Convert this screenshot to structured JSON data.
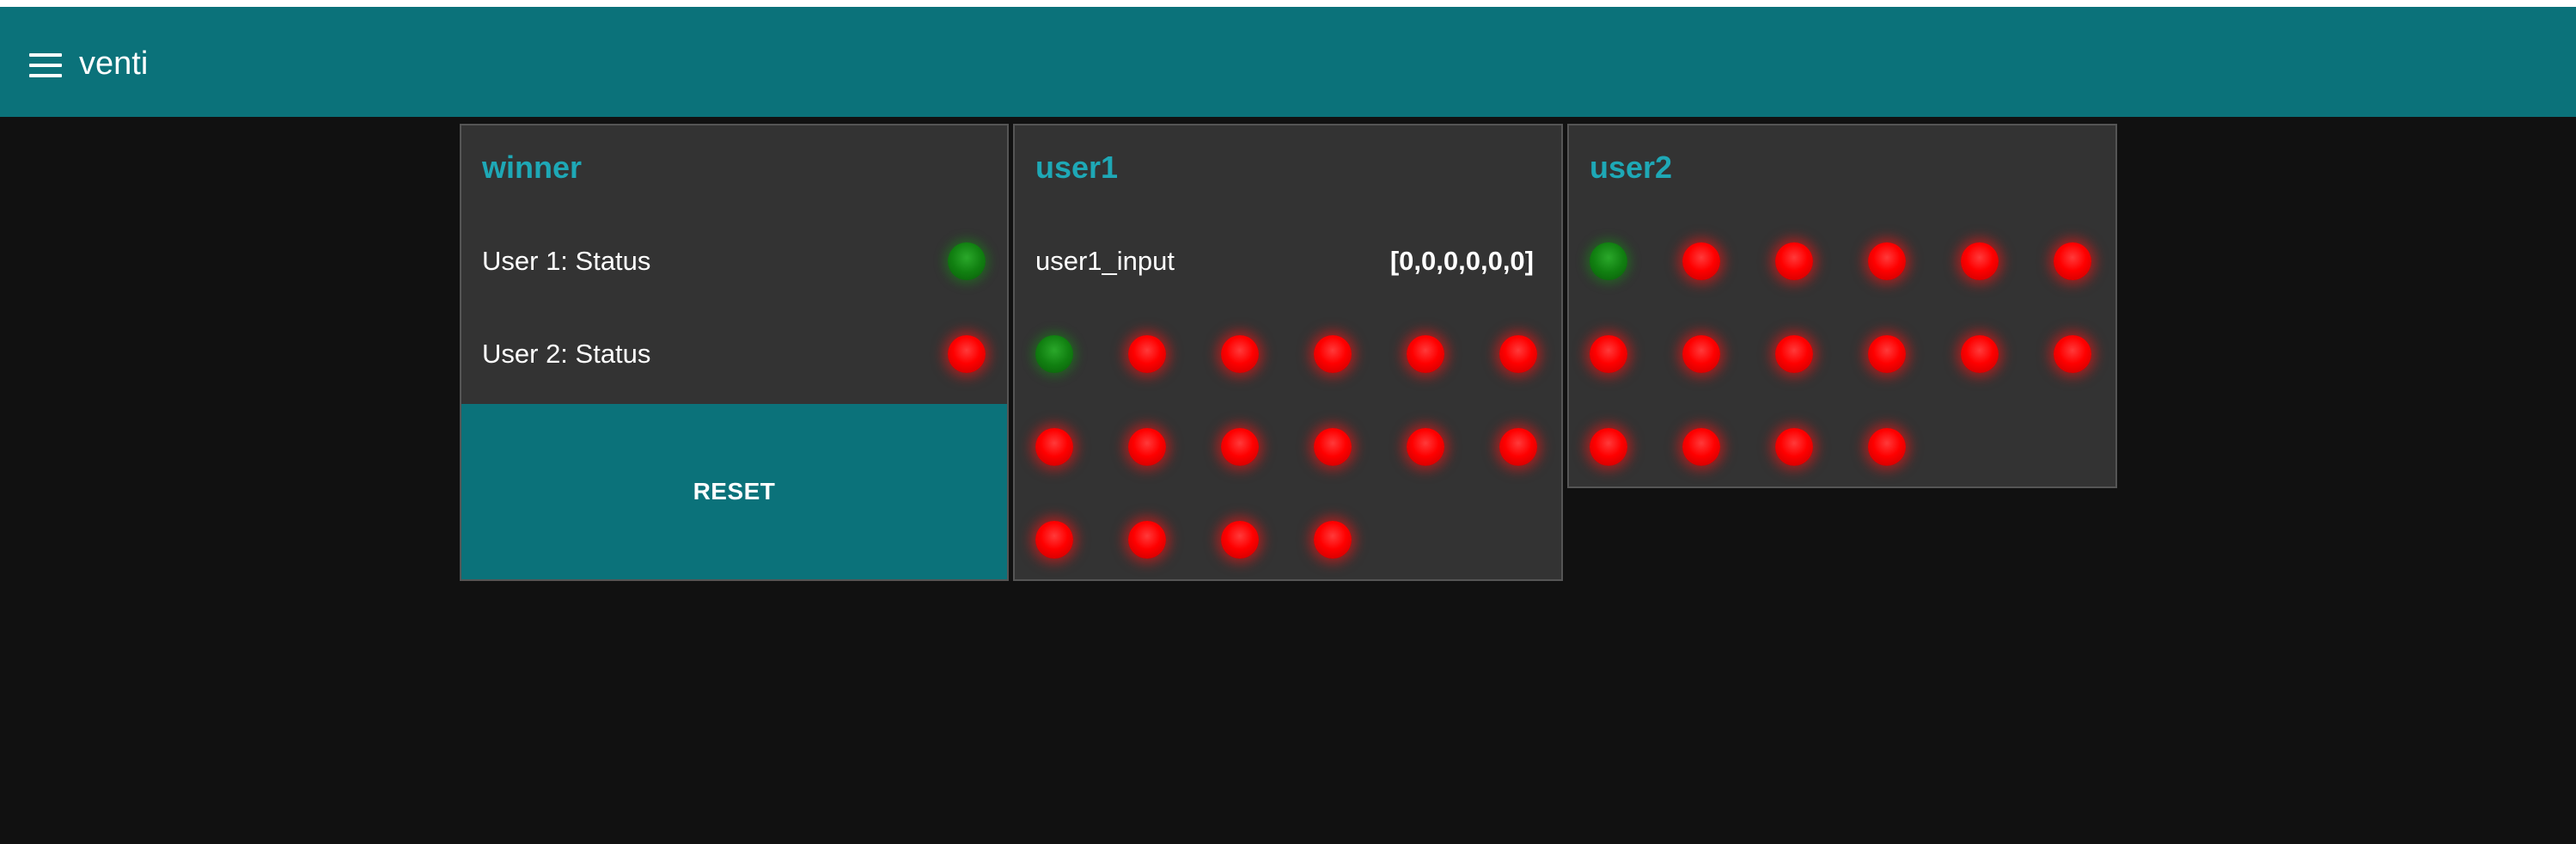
{
  "app": {
    "title": "venti",
    "menu_icon": "hamburger-menu-icon"
  },
  "colors": {
    "header_bg": "#0b727a",
    "page_bg": "#111111",
    "card_bg": "#333333",
    "title_accent": "#1ea8b6",
    "led_on": "#ff0000",
    "led_off": "#118011"
  },
  "winner": {
    "title": "winner",
    "rows": [
      {
        "label": "User 1: Status",
        "led": "green"
      },
      {
        "label": "User 2: Status",
        "led": "red"
      }
    ],
    "reset_label": "RESET"
  },
  "user1": {
    "title": "user1",
    "input_label": "user1_input",
    "input_value": "[0,0,0,0,0,0]",
    "leds": [
      "green",
      "red",
      "red",
      "red",
      "red",
      "red",
      "red",
      "red",
      "red",
      "red",
      "red",
      "red",
      "red",
      "red",
      "red",
      "red"
    ]
  },
  "user2": {
    "title": "user2",
    "leds": [
      "green",
      "red",
      "red",
      "red",
      "red",
      "red",
      "red",
      "red",
      "red",
      "red",
      "red",
      "red",
      "red",
      "red",
      "red",
      "red"
    ]
  }
}
